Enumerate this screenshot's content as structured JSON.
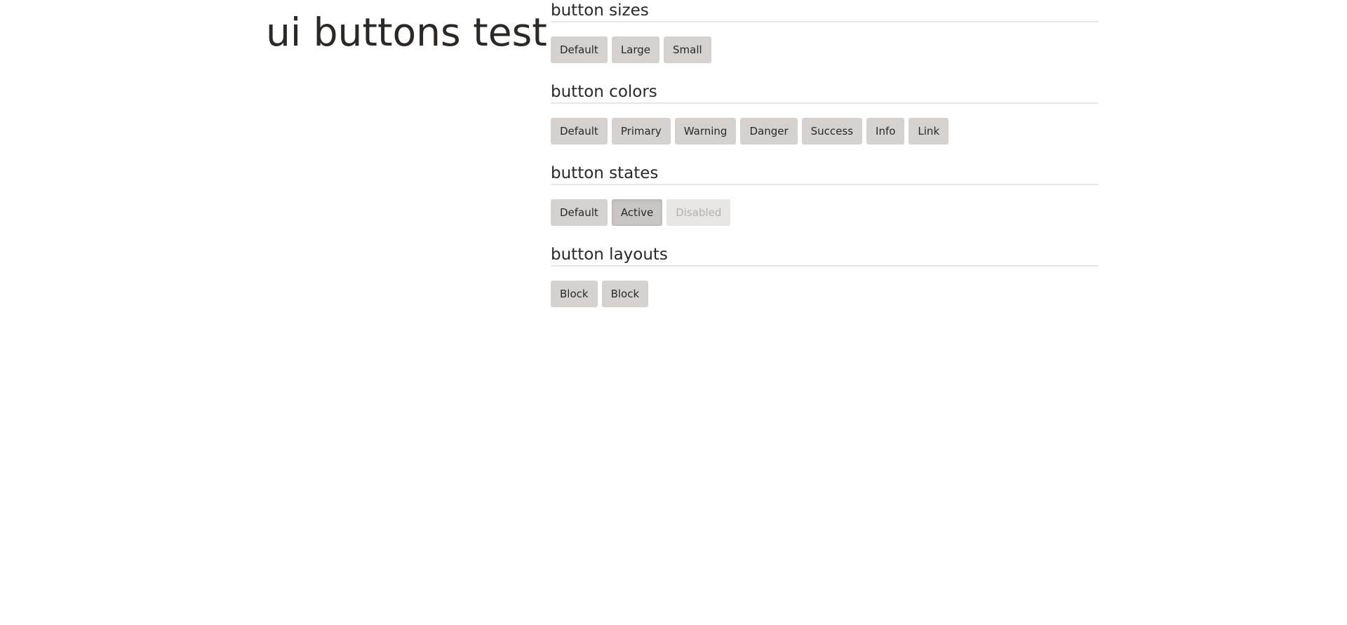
{
  "page": {
    "title": "ui buttons test"
  },
  "sections": [
    {
      "heading": "button sizes",
      "buttons": [
        "Default",
        "Large",
        "Small"
      ]
    },
    {
      "heading": "button colors",
      "buttons": [
        "Default",
        "Primary",
        "Warning",
        "Danger",
        "Success",
        "Info",
        "Link"
      ]
    },
    {
      "heading": "button states",
      "buttons": [
        "Default",
        "Active",
        "Disabled"
      ]
    },
    {
      "heading": "button layouts",
      "buttons": [
        "Block",
        "Block"
      ]
    }
  ],
  "colors": {
    "button_bg": "#d4d1cf",
    "button_text": "#2b2826",
    "disabled_bg": "#e8e6e5",
    "disabled_text": "#b3b0ae",
    "divider": "#e8e6e4"
  }
}
